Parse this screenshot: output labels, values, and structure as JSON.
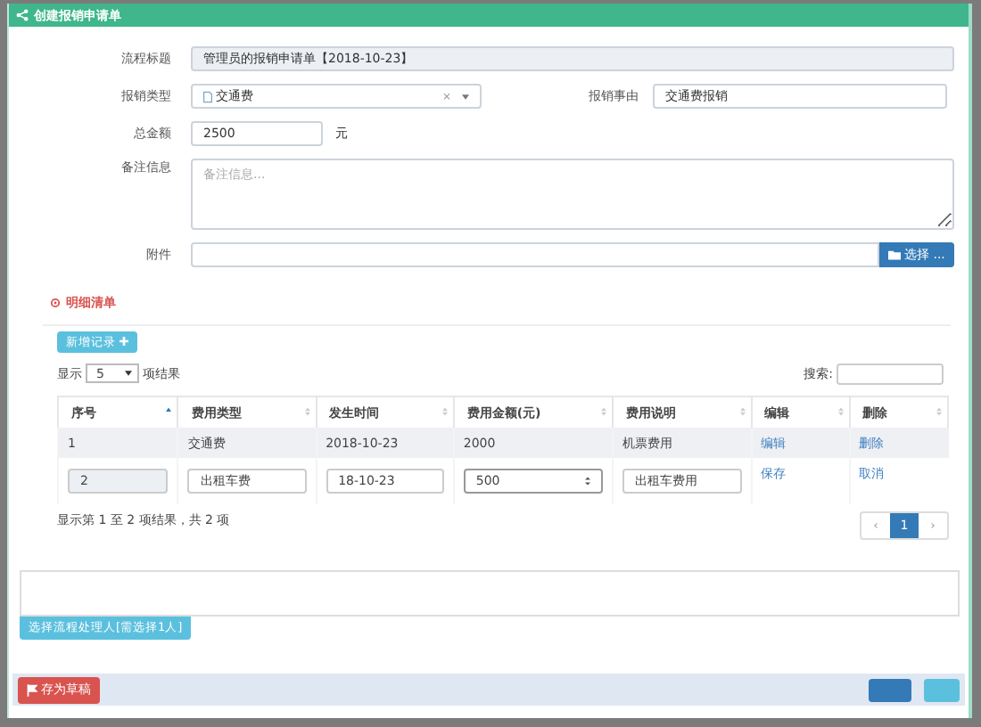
{
  "dialog": {
    "title": "创建报销申请单"
  },
  "form": {
    "title_label": "流程标题",
    "title_value": "管理员的报销申请单【2018-10-23】",
    "type_label": "报销类型",
    "type_value": "交通费",
    "type_clear": "×",
    "reason_label": "报销事由",
    "reason_value": "交通费报销",
    "amount_label": "总金额",
    "amount_value": "2500",
    "amount_unit": "元",
    "note_label": "备注信息",
    "note_placeholder": "备注信息...",
    "attach_label": "附件",
    "attach_button": "选择 ..."
  },
  "detail": {
    "heading": "明细清单",
    "add_button": "新增记录",
    "length_prefix": "显示",
    "length_value": "5",
    "length_suffix": "项结果",
    "search_label": "搜索:",
    "columns": [
      {
        "label": "序号",
        "sorted": true
      },
      {
        "label": "费用类型",
        "sorted": false
      },
      {
        "label": "发生时间",
        "sorted": false
      },
      {
        "label": "费用金额(元)",
        "sorted": false
      },
      {
        "label": "费用说明",
        "sorted": false
      },
      {
        "label": "编辑",
        "sorted": false
      },
      {
        "label": "删除",
        "sorted": false
      }
    ],
    "rows": [
      {
        "editing": false,
        "cells": [
          "1",
          "交通费",
          "2018-10-23",
          "2000",
          "机票费用"
        ],
        "edit_link": "编辑",
        "delete_link": "删除"
      },
      {
        "editing": true,
        "cells": [
          "2",
          "出租车费",
          "18-10-23",
          "500",
          "出租车费用"
        ],
        "edit_link": "保存",
        "delete_link": "取消"
      }
    ],
    "info": "显示第 1 至 2 项结果，共 2 项",
    "pages": [
      {
        "label": "‹",
        "selected": false
      },
      {
        "label": "1",
        "selected": true
      },
      {
        "label": "›",
        "selected": false
      }
    ]
  },
  "handler_button": "选择流程处理人[需选择1人]",
  "draft_button": "存为草稿"
}
